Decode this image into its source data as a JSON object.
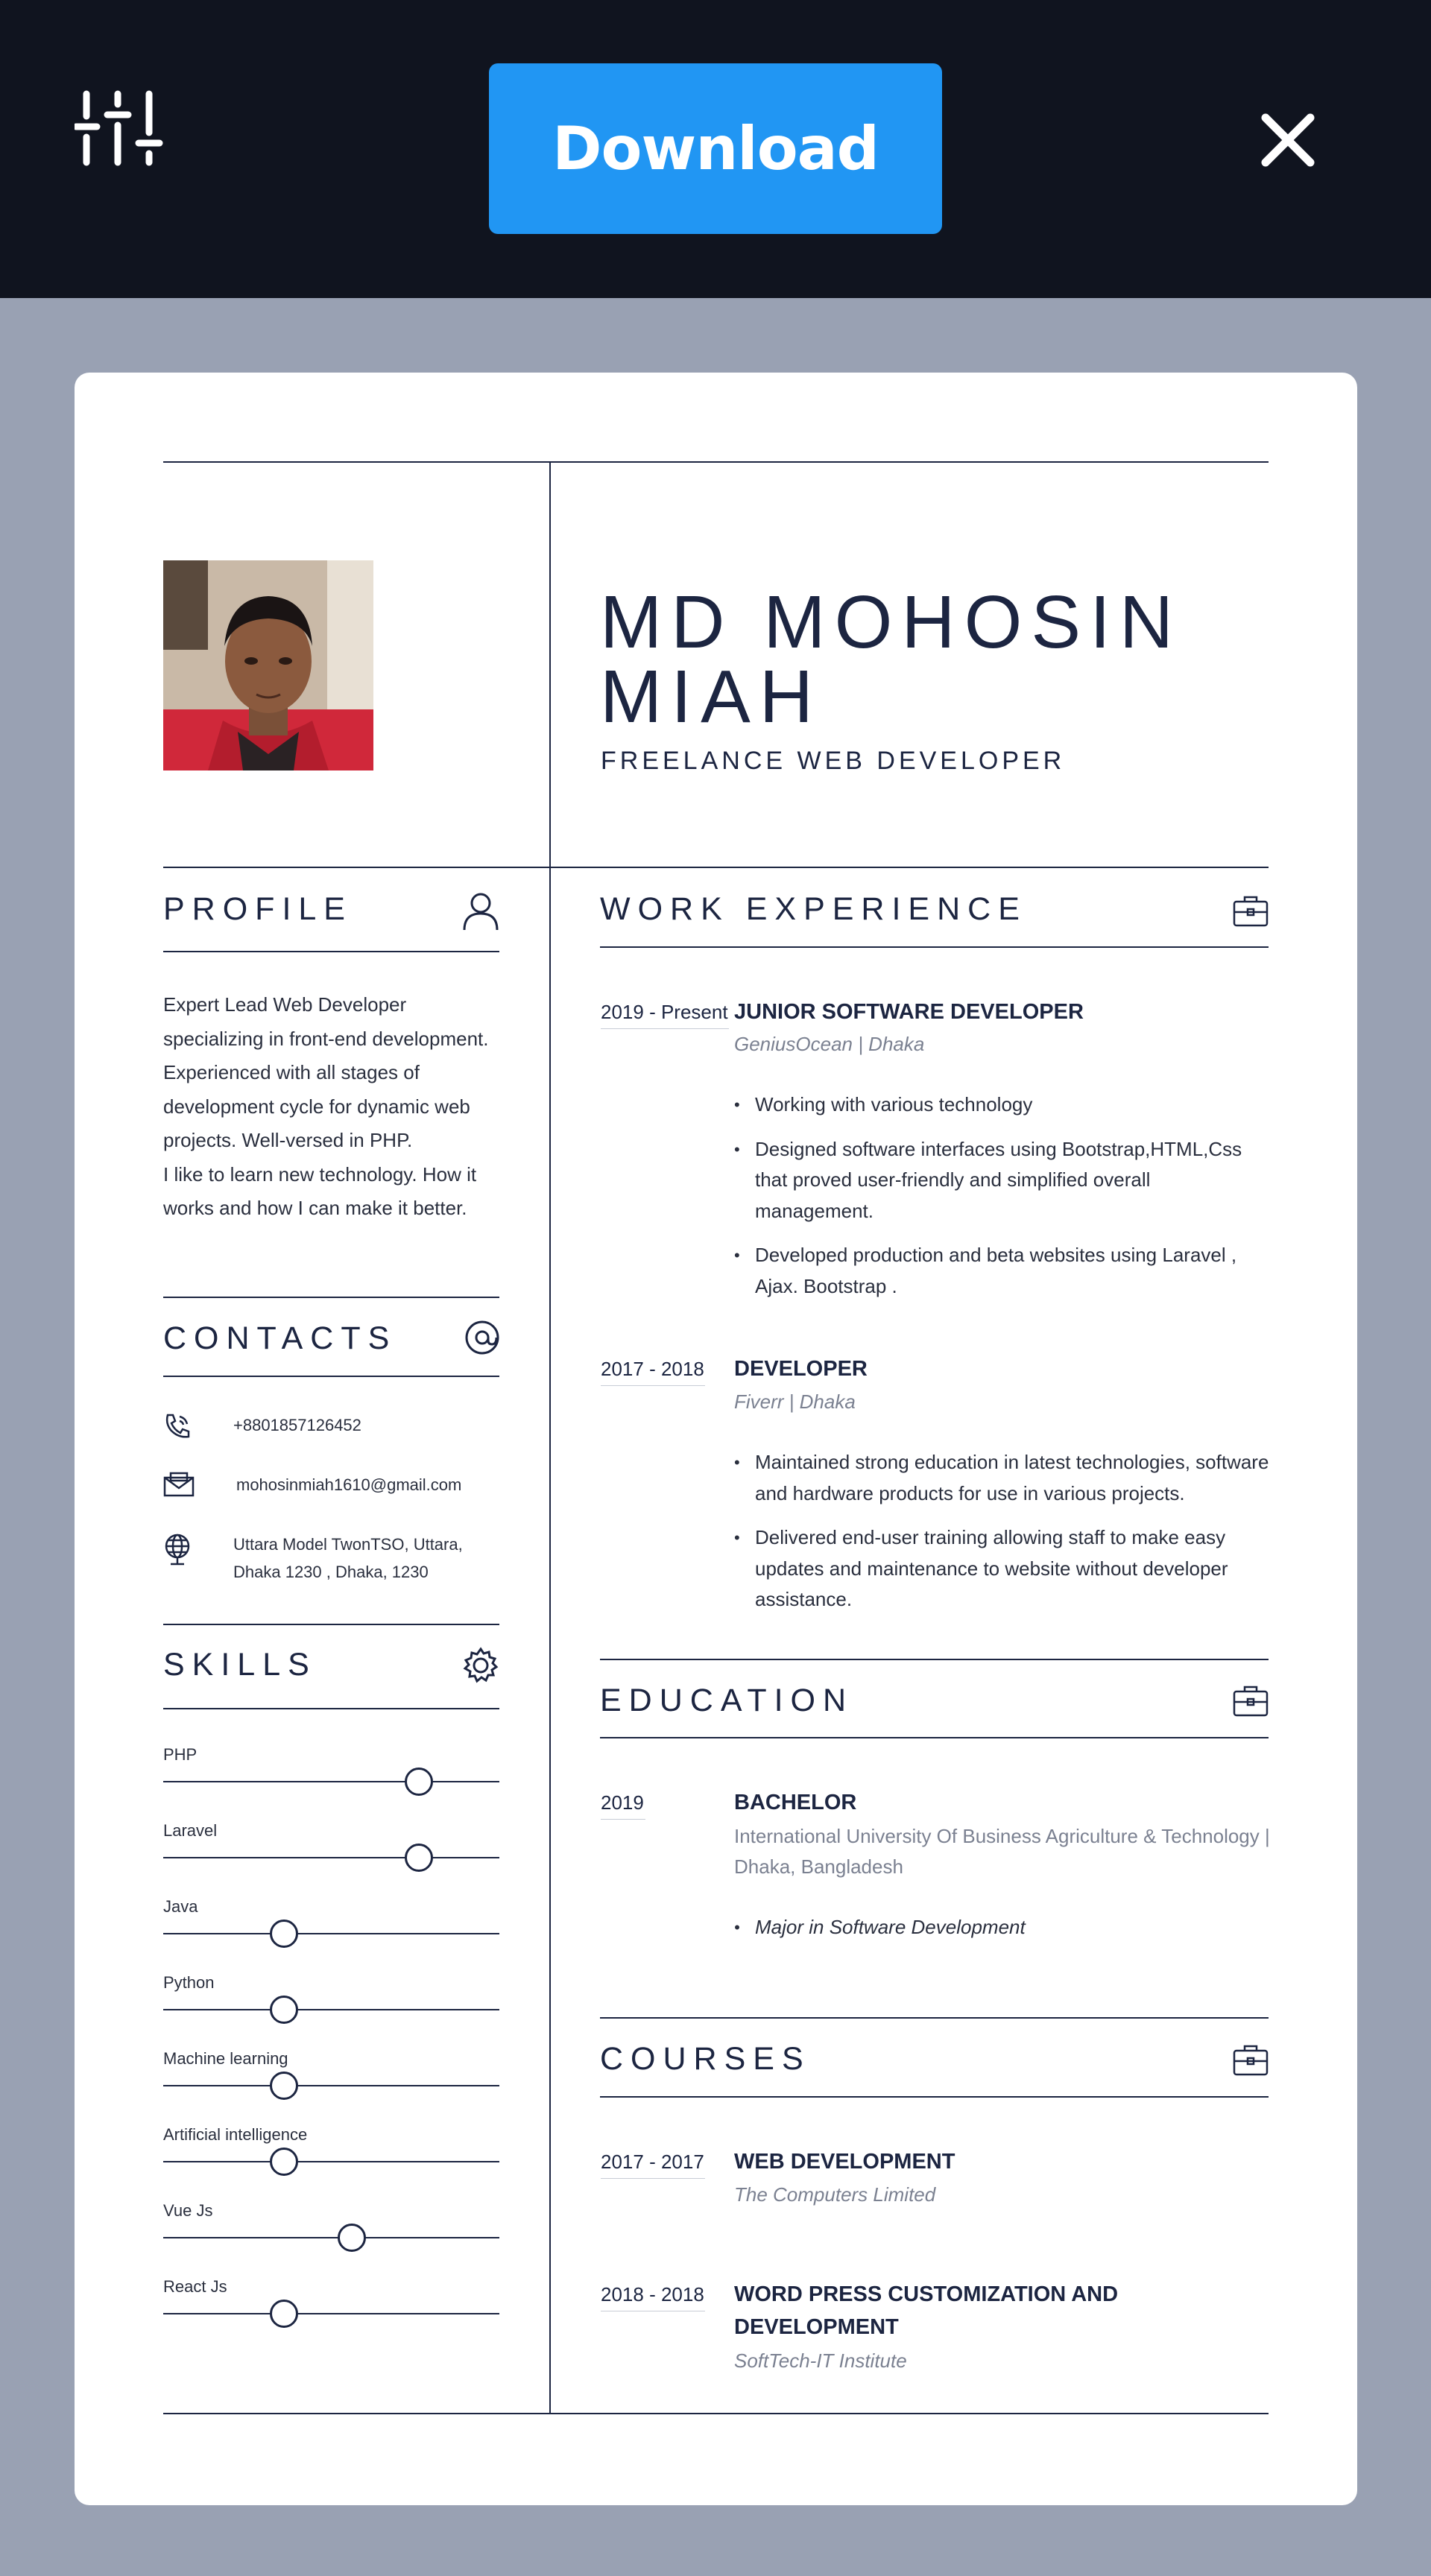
{
  "toolbar": {
    "download_label": "Download"
  },
  "resume": {
    "name_line1": "MD MOHOSIN",
    "name_line2": "MIAH",
    "role": "FREELANCE WEB DEVELOPER",
    "profile": {
      "title": "PROFILE",
      "text": "Expert Lead Web Developer specializing in front-end development. Experienced with all stages of development cycle for dynamic web projects. Well-versed in PHP.",
      "text2": "I like to learn new technology. How it works and how I can make it better."
    },
    "contacts": {
      "title": "CONTACTS",
      "phone": "+8801857126452",
      "email": "mohosinmiah1610@gmail.com",
      "address_line1": "Uttara Model TwonTSO, Uttara,",
      "address_line2": "Dhaka 1230 , Dhaka, 1230"
    },
    "skills": {
      "title": "SKILLS",
      "items": [
        {
          "name": "PHP",
          "level": 0.76
        },
        {
          "name": "Laravel",
          "level": 0.76
        },
        {
          "name": "Java",
          "level": 0.36
        },
        {
          "name": "Python",
          "level": 0.36
        },
        {
          "name": "Machine learning",
          "level": 0.36
        },
        {
          "name": "Artificial intelligence",
          "level": 0.36
        },
        {
          "name": "Vue Js",
          "level": 0.56
        },
        {
          "name": "React Js",
          "level": 0.36
        }
      ]
    },
    "work": {
      "title": "WORK EXPERIENCE",
      "jobs": [
        {
          "date": "2019 - Present",
          "title": "JUNIOR SOFTWARE DEVELOPER",
          "company": "GeniusOcean | Dhaka",
          "bullets": [
            "Working with various technology",
            "Designed software interfaces using Bootstrap,HTML,Css that proved user-friendly and simplified overall management.",
            "Developed production and beta websites using Laravel , Ajax. Bootstrap ."
          ]
        },
        {
          "date": "2017 - 2018",
          "title": "DEVELOPER",
          "company": "Fiverr | Dhaka",
          "bullets": [
            "Maintained strong education in latest technologies, software and hardware products for use in various projects.",
            "Delivered end-user training allowing staff to make easy updates and maintenance to website without developer assistance."
          ]
        }
      ]
    },
    "education": {
      "title": "EDUCATION",
      "date": "2019",
      "degree": "BACHELOR",
      "school": "International University Of Business Agriculture & Technology | Dhaka, Bangladesh",
      "bullets": [
        "Major in Software Development"
      ]
    },
    "courses": {
      "title": "COURSES",
      "items": [
        {
          "date": "2017 - 2017",
          "title": "WEB DEVELOPMENT",
          "institute": "The Computers Limited"
        },
        {
          "date": "2018 - 2018",
          "title": "WORD PRESS CUSTOMIZATION AND DEVELOPMENT",
          "institute": "SoftTech-IT Institute"
        }
      ]
    }
  }
}
